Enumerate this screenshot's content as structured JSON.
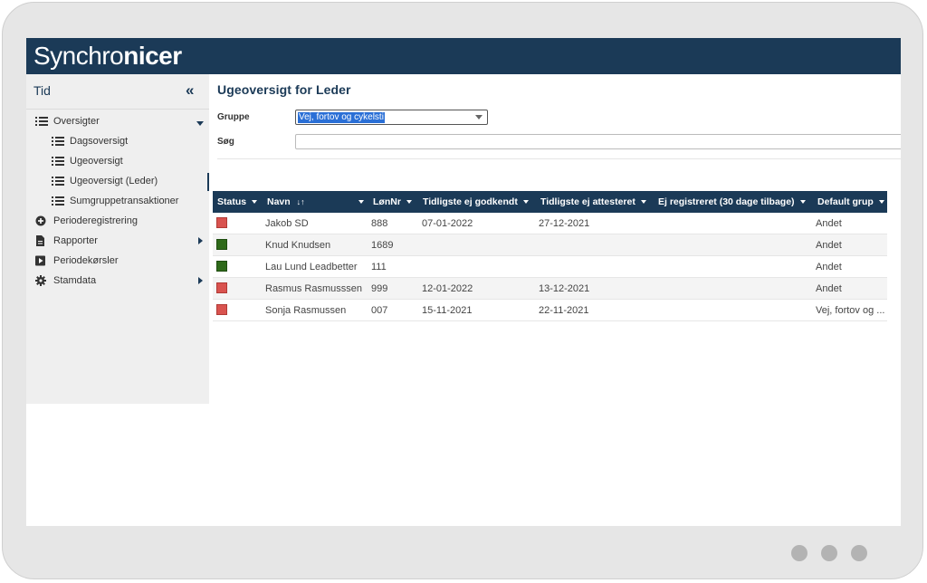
{
  "app": {
    "logo_regular": "Synchro",
    "logo_bold": "nicer"
  },
  "sidebar": {
    "title": "Tid",
    "collapse_icon": "«",
    "items": [
      {
        "label": "Oversigter"
      },
      {
        "label": "Dagsoversigt"
      },
      {
        "label": "Ugeoversigt"
      },
      {
        "label": "Ugeoversigt (Leder)"
      },
      {
        "label": "Sumgruppetransaktioner"
      },
      {
        "label": "Perioderegistrering"
      },
      {
        "label": "Rapporter"
      },
      {
        "label": "Periodekørsler"
      },
      {
        "label": "Stamdata"
      }
    ]
  },
  "main": {
    "title": "Ugeoversigt for Leder",
    "group_label": "Gruppe",
    "group_value": "Vej, fortov og cykelsti",
    "search_label": "Søg",
    "search_value": ""
  },
  "table": {
    "headers": [
      "Status",
      "Navn",
      "LønNr",
      "Tidligste ej godkendt",
      "Tidligste ej attesteret",
      "Ej registreret (30 dage tilbage)",
      "Default grup"
    ],
    "sort_icon": "↓↑",
    "rows": [
      {
        "status": "red",
        "name": "Jakob SD",
        "lonnr": "888",
        "ej_godkendt": "07-01-2022",
        "ej_attesteret": "27-12-2021",
        "ej_registreret": "",
        "default_group": "Andet"
      },
      {
        "status": "green",
        "name": "Knud Knudsen",
        "lonnr": "1689",
        "ej_godkendt": "",
        "ej_attesteret": "",
        "ej_registreret": "",
        "default_group": "Andet"
      },
      {
        "status": "green",
        "name": "Lau Lund Leadbetter",
        "lonnr": "111",
        "ej_godkendt": "",
        "ej_attesteret": "",
        "ej_registreret": "",
        "default_group": "Andet"
      },
      {
        "status": "red",
        "name": "Rasmus Rasmusssen",
        "lonnr": "999",
        "ej_godkendt": "12-01-2022",
        "ej_attesteret": "13-12-2021",
        "ej_registreret": "",
        "default_group": "Andet"
      },
      {
        "status": "red",
        "name": "Sonja Rasmussen",
        "lonnr": "007",
        "ej_godkendt": "15-11-2021",
        "ej_attesteret": "22-11-2021",
        "ej_registreret": "",
        "default_group": "Vej, fortov og ..."
      }
    ]
  },
  "colors": {
    "brand": "#1b3a57",
    "status_red": "#d9534f",
    "status_green": "#2f6a1a"
  }
}
